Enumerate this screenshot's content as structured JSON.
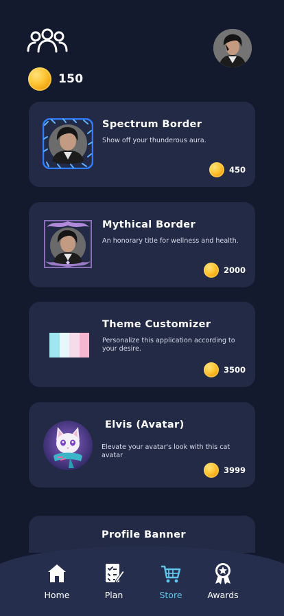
{
  "header": {
    "coin_balance": "150",
    "group_icon": "group-icon",
    "avatar_icon": "profile-avatar"
  },
  "store": {
    "items": [
      {
        "title": "Spectrum Border",
        "description": "Show off your thunderous aura.",
        "price": "450",
        "thumb": "spectrum-border-avatar"
      },
      {
        "title": "Mythical Border",
        "description": "An honorary title for wellness and health.",
        "price": "2000",
        "thumb": "mythical-border-avatar"
      },
      {
        "title": "Theme Customizer",
        "description": "Personalize this application according to your desire.",
        "price": "3500",
        "thumb": "theme-swatch",
        "swatch_colors": [
          "#9fe6f1",
          "#e6f8fb",
          "#f6dbea",
          "#f5b7cf"
        ]
      },
      {
        "title": "Elvis (Avatar)",
        "description": "Elevate your avatar's look with this  cat avatar",
        "price": "3999",
        "thumb": "cat-avatar"
      },
      {
        "title": "Profile Banner",
        "description": "",
        "price": "",
        "thumb": ""
      }
    ]
  },
  "nav": {
    "items": [
      {
        "label": "Home",
        "icon": "home-icon",
        "active": false
      },
      {
        "label": "Plan",
        "icon": "plan-icon",
        "active": false
      },
      {
        "label": "Store",
        "icon": "cart-icon",
        "active": true
      },
      {
        "label": "Awards",
        "icon": "award-icon",
        "active": false
      }
    ]
  },
  "colors": {
    "background": "#141a2e",
    "card": "#222a46",
    "nav": "#262e4e",
    "accent": "#5fc4e8",
    "coin": "#ffc83a"
  }
}
